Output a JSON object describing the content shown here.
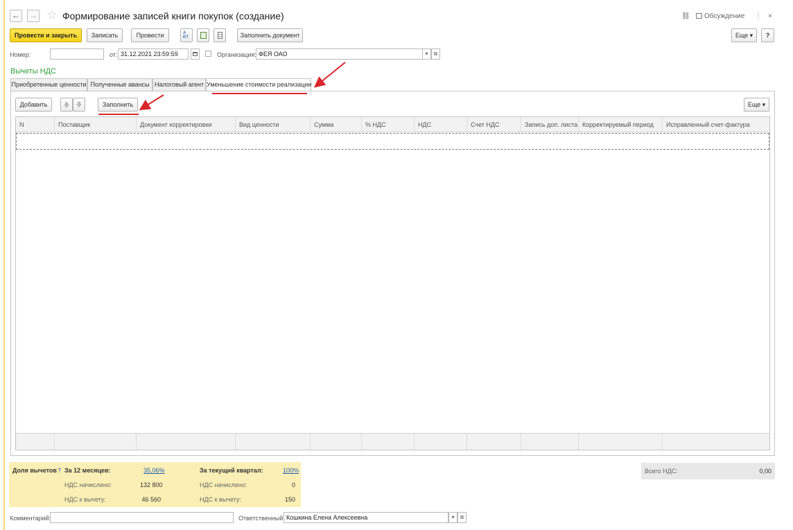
{
  "window": {
    "title": "Формирование записей книги покупок (создание)",
    "discussion_label": "Обсуждение",
    "more_dots": "⋮",
    "close_symbol": "×",
    "back_symbol": "←",
    "forward_symbol": "→",
    "star_symbol": "☆",
    "link_symbol": "⛓"
  },
  "toolbar": {
    "post_and_close": "Провести и закрыть",
    "save": "Записать",
    "post": "Провести",
    "fill_document": "Заполнить документ",
    "more": "Еще ▾",
    "help": "?"
  },
  "header_fields": {
    "number_label": "Номер:",
    "number_value": "",
    "date_label": "от:",
    "date_value": "31.12.2021 23:59:59",
    "org_label": "Организация:",
    "org_value": "ФЕЯ ОАО"
  },
  "section_title": "Вычеты НДС",
  "tabs": [
    {
      "label": "Приобретенные ценности"
    },
    {
      "label": "Полученные авансы"
    },
    {
      "label": "Налоговый агент"
    },
    {
      "label": "Уменьшение стоимости реализации"
    }
  ],
  "table_toolbar": {
    "add": "Добавить",
    "up": "🡅",
    "down": "🡇",
    "fill": "Заполнить",
    "more": "Еще ▾"
  },
  "table": {
    "columns": [
      "N",
      "Поставщик",
      "Документ корректировки",
      "Вид ценности",
      "Сумма",
      "% НДС",
      "НДС",
      "Счет НДС",
      "Запись доп. листа",
      "Корректируемый период",
      "Исправленный счет-фактура"
    ]
  },
  "summary": {
    "share_label": "Доля вычетов",
    "help_mark": "?",
    "months12_label": "За 12 месяцев:",
    "months12_value": "35,06%",
    "quarter_label": "За текущий квартал:",
    "quarter_value": "100%",
    "accrued_label": "НДС начислено:",
    "accrued_12": "132 800",
    "accrued_q": "0",
    "deduct_label": "НДС к вычету:",
    "deduct_12": "46 560",
    "deduct_q": "150"
  },
  "total_vat": {
    "label": "Всего НДС:",
    "value": "0,00"
  },
  "footer": {
    "comment_label": "Комментарий:",
    "comment_value": "",
    "responsible_label": "Ответственный:",
    "responsible_value": "Кошкина Елена Алексеевна"
  },
  "colors": {
    "accent_yellow": "#f5d21c",
    "summary_bg": "#fbefb5",
    "section_green": "#2f9e3a",
    "annotation_red": "#d9262c"
  }
}
